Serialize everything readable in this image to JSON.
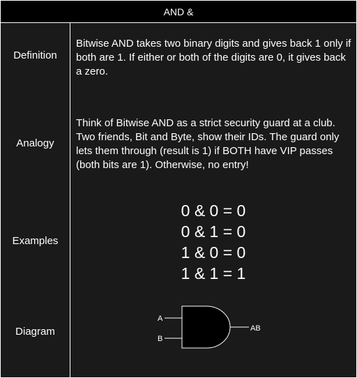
{
  "title": "AND &",
  "rows": {
    "definition": {
      "label": "Definition",
      "text": "Bitwise AND takes two binary digits and gives back 1 only if both are 1. If either or both of the digits are 0, it gives back a zero."
    },
    "analogy": {
      "label": "Analogy",
      "text": "Think of Bitwise AND as a strict security guard at a club. Two friends, Bit and Byte, show their IDs. The guard only lets them through (result is 1) if BOTH have VIP passes (both bits are 1). Otherwise, no entry!"
    },
    "examples": {
      "label": "Examples",
      "lines": [
        "0 & 0 = 0",
        "0 & 1 = 0",
        "1 & 0 = 0",
        "1 & 1 = 1"
      ]
    },
    "diagram": {
      "label": "Diagram",
      "input_a": "A",
      "input_b": "B",
      "output": "AB",
      "gate_icon": "and-gate-icon"
    }
  },
  "colors": {
    "background": "#1a1a1a",
    "header_background": "#000000",
    "border": "#ffffff",
    "text": "#ffffff"
  }
}
